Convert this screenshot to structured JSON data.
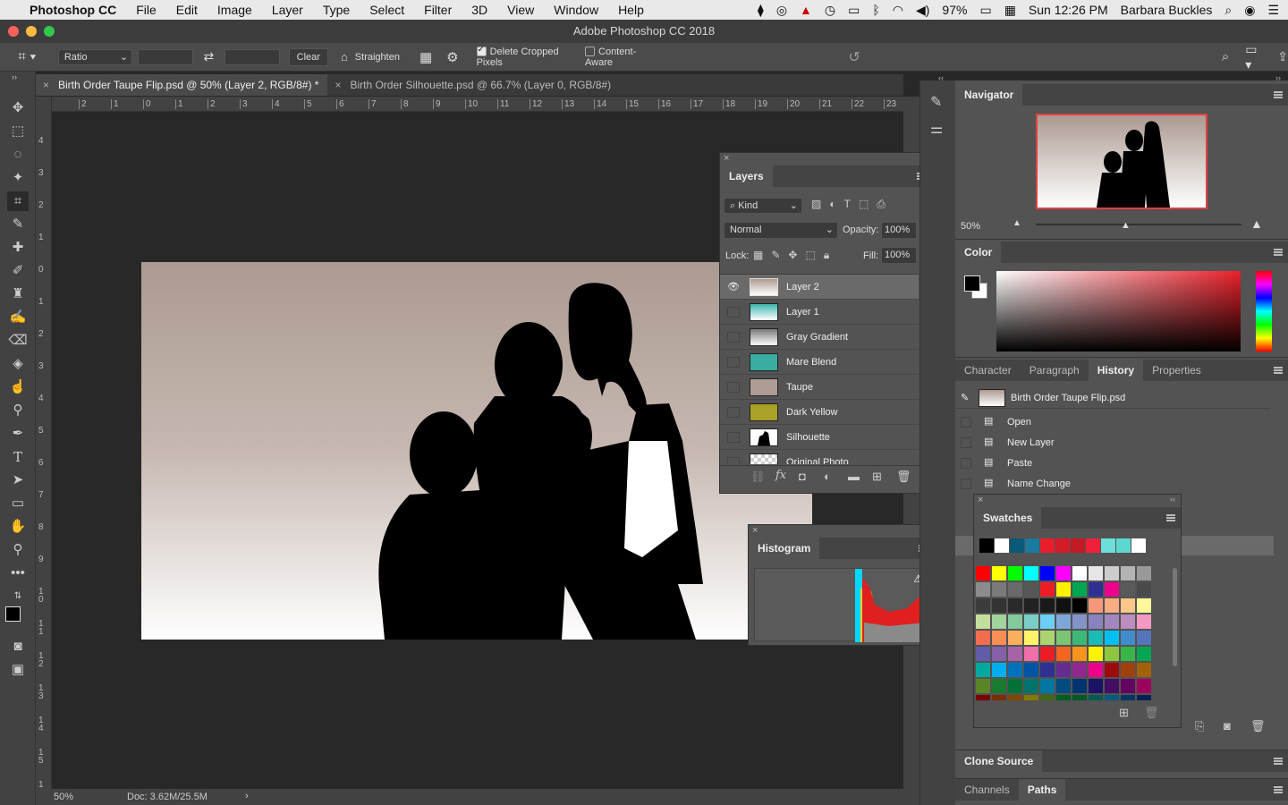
{
  "menubar": {
    "app_name": "Photoshop CC",
    "items": [
      "File",
      "Edit",
      "Image",
      "Layer",
      "Type",
      "Select",
      "Filter",
      "3D",
      "View",
      "Window",
      "Help"
    ],
    "battery": "97%",
    "clock": "Sun 12:26 PM",
    "user": "Barbara Buckles"
  },
  "window": {
    "title": "Adobe Photoshop CC 2018"
  },
  "options": {
    "ratio": "Ratio",
    "clear": "Clear",
    "straighten": "Straighten",
    "delete_cropped": "Delete Cropped Pixels",
    "content_aware": "Content-Aware",
    "delete_cropped_checked": true,
    "content_aware_checked": false
  },
  "tabs": [
    {
      "label": "Birth Order Taupe Flip.psd @ 50% (Layer 2, RGB/8#) *",
      "active": true
    },
    {
      "label": "Birth Order Silhouette.psd @ 66.7% (Layer 0, RGB/8#)",
      "active": false
    }
  ],
  "ruler_top": [
    "2",
    "1",
    "0",
    "1",
    "2",
    "3",
    "4",
    "5",
    "6",
    "7",
    "8",
    "9",
    "10",
    "11",
    "12",
    "13",
    "14",
    "15",
    "16",
    "17",
    "18",
    "19",
    "20",
    "21",
    "22",
    "23"
  ],
  "ruler_left": [
    "4",
    "3",
    "2",
    "1",
    "0",
    "1",
    "2",
    "3",
    "4",
    "5",
    "6",
    "7",
    "8",
    "9",
    "1 0",
    "1 1",
    "1 2",
    "1 3",
    "1 4",
    "1 5",
    "1"
  ],
  "status": {
    "zoom": "50%",
    "doc": "Doc: 3.62M/25.5M"
  },
  "layers_panel": {
    "title": "Layers",
    "kind": "Kind",
    "blend_mode": "Normal",
    "opacity_label": "Opacity:",
    "opacity": "100%",
    "lock_label": "Lock:",
    "fill_label": "Fill:",
    "fill": "100%",
    "layers": [
      {
        "name": "Layer 2",
        "thumb": "#d8ccc6",
        "visible": true,
        "selected": true
      },
      {
        "name": "Layer 1",
        "thumb": "#62c9c0",
        "visible": false,
        "selected": false
      },
      {
        "name": "Gray Gradient",
        "thumb": "#9a9a9a",
        "visible": false,
        "selected": false
      },
      {
        "name": "Mare Blend",
        "thumb": "#3aaca2",
        "visible": false,
        "selected": false
      },
      {
        "name": "Taupe",
        "thumb": "#ad9d94",
        "visible": false,
        "selected": false
      },
      {
        "name": "Dark Yellow",
        "thumb": "#a9a128",
        "visible": false,
        "selected": false
      },
      {
        "name": "Silhouette",
        "thumb": "#ffffff",
        "visible": false,
        "selected": false
      },
      {
        "name": "Original Photo",
        "thumb": "#cccccc",
        "visible": false,
        "selected": false
      }
    ]
  },
  "histogram": {
    "title": "Histogram"
  },
  "navigator": {
    "title": "Navigator",
    "zoom": "50%"
  },
  "color_panel": {
    "title": "Color",
    "accent": "#e8202a"
  },
  "history_tabs": [
    "Character",
    "Paragraph",
    "History",
    "Properties"
  ],
  "history": {
    "snapshot": "Birth Order Taupe Flip.psd",
    "steps": [
      "Open",
      "New Layer",
      "Paste",
      "Name Change"
    ]
  },
  "swatches": {
    "title": "Swatches",
    "recent": [
      "#000000",
      "#ffffff",
      "#0a5a78",
      "#1a7aa0",
      "#e81e2a",
      "#d41c28",
      "#c41a26",
      "#f0203a",
      "#6ce0d8",
      "#5cd8d0",
      "#ffffff"
    ],
    "grid": [
      [
        "#ff0000",
        "#ffff00",
        "#00ff00",
        "#00ffff",
        "#0000ff",
        "#ff00ff",
        "#ffffff",
        "#e6e6e6",
        "#cccccc",
        "#b3b3b3",
        "#999999"
      ],
      [
        "#8c8c8c",
        "#7a7a7a",
        "#696969",
        "#575757",
        "#ee1d24",
        "#fff200",
        "#00a651",
        "#2e3192",
        "#ec008c",
        "#5a5a5a",
        "#4a4a4a"
      ],
      [
        "#3c3c3c",
        "#333333",
        "#2a2a2a",
        "#222222",
        "#1a1a1a",
        "#111111",
        "#000000",
        "#f7977a",
        "#f9ad81",
        "#fdc68a",
        "#fff79a"
      ],
      [
        "#c4df9b",
        "#a2d39c",
        "#82ca9d",
        "#7bcdc8",
        "#6ecff6",
        "#7ea7d8",
        "#8493ca",
        "#8882be",
        "#a187be",
        "#bc8dbf",
        "#f49ac2"
      ],
      [
        "#f26c4f",
        "#f68e55",
        "#fbaf5c",
        "#fff467",
        "#acd372",
        "#7cc576",
        "#3bb878",
        "#1abbb4",
        "#00bff3",
        "#438ccb",
        "#5574b9"
      ],
      [
        "#605ca8",
        "#855fa8",
        "#a763a8",
        "#f06eaa",
        "#ed1c24",
        "#f26522",
        "#f7941d",
        "#fff200",
        "#8dc73f",
        "#39b54a",
        "#00a651"
      ],
      [
        "#00a99d",
        "#00aeef",
        "#0072bc",
        "#0054a6",
        "#2e3192",
        "#662d91",
        "#92278f",
        "#ec008c",
        "#9e0b0f",
        "#a0410d",
        "#a36209"
      ],
      [
        "#598527",
        "#197b30",
        "#007236",
        "#00746b",
        "#0076a3",
        "#004b80",
        "#003471",
        "#1b1464",
        "#440e62",
        "#630460",
        "#9e005d"
      ],
      [
        "#790000",
        "#7b2e00",
        "#7d4900",
        "#827b00",
        "#406618",
        "#005e20",
        "#005826",
        "#005952",
        "#005b7f",
        "#003663",
        "#002157"
      ]
    ]
  },
  "bottom_panels": {
    "clone_source": "Clone Source",
    "channels": "Channels",
    "paths": "Paths"
  }
}
